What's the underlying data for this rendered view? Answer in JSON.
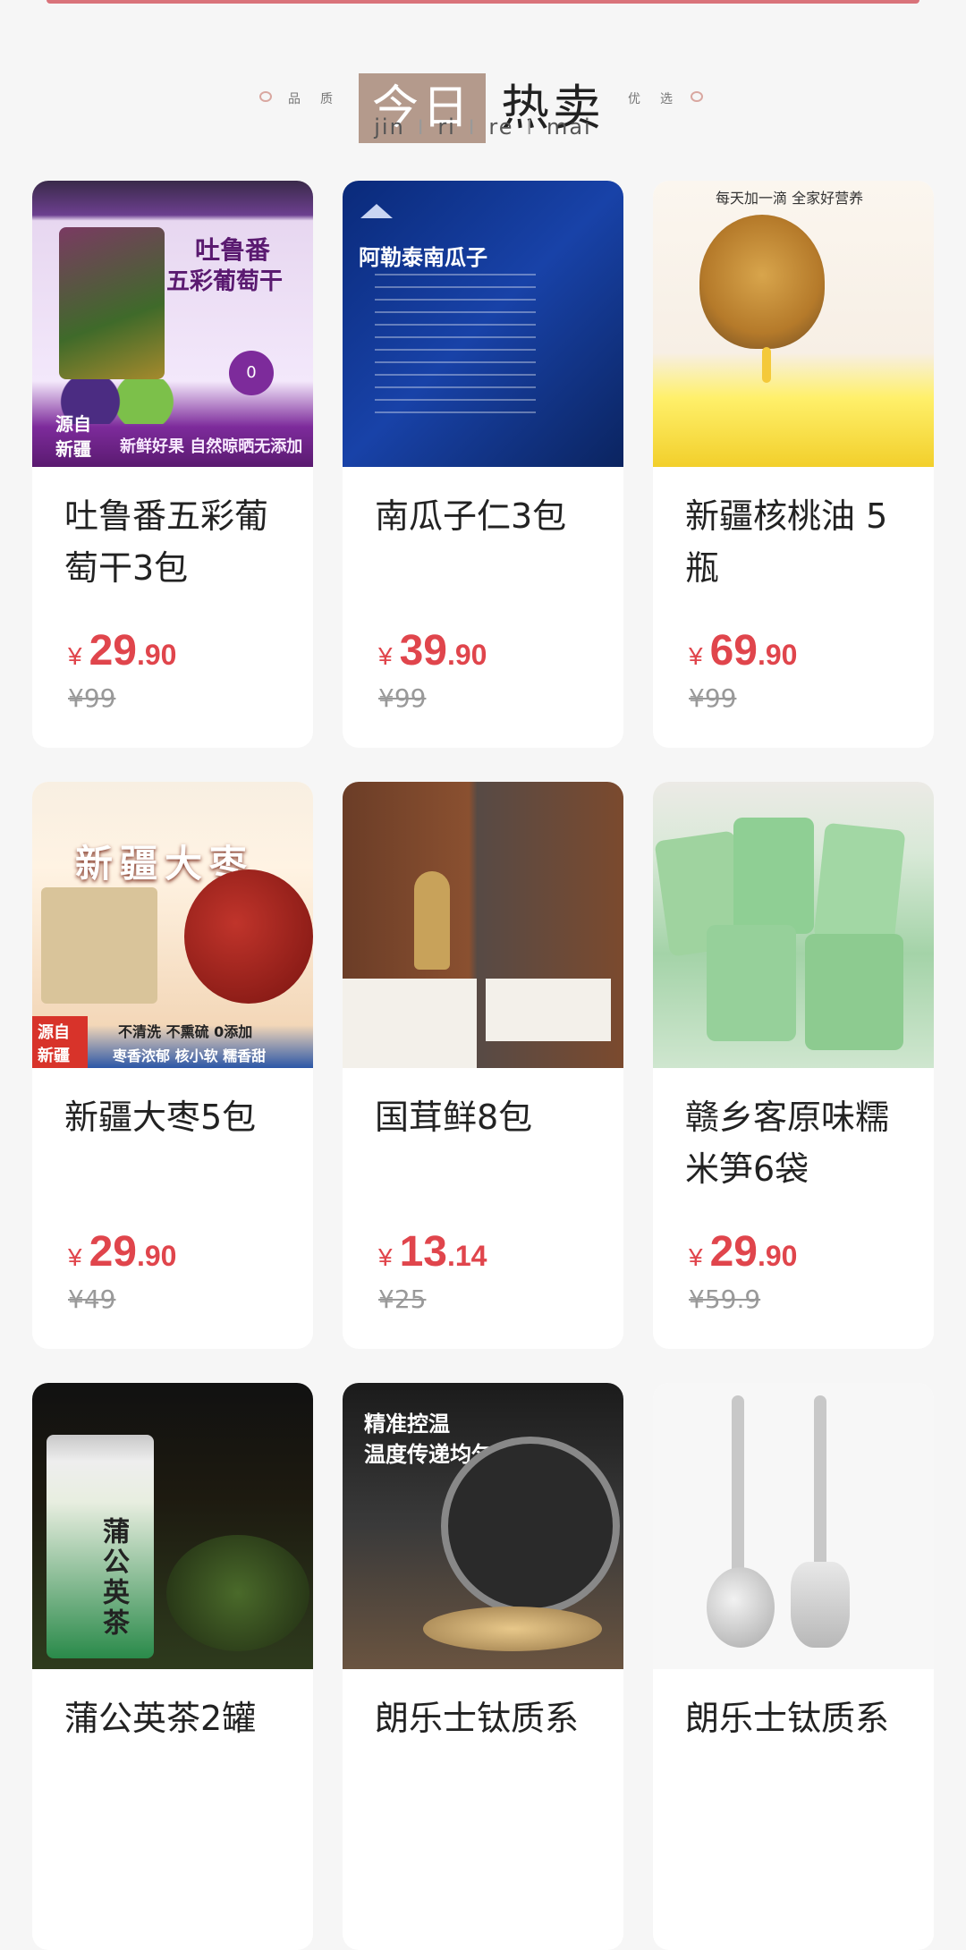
{
  "header": {
    "side_left": "品质",
    "side_right": "优选",
    "today": "今日",
    "hot": "热卖",
    "pinyin": [
      "jin",
      "ri",
      "re",
      "mai"
    ]
  },
  "colors": {
    "price": "#e0454c",
    "accent_box": "#b49a8c",
    "top_bar": "#d9737a"
  },
  "products": [
    {
      "title": "吐鲁番五彩葡萄干3包",
      "price_int": "29",
      "price_dec": ".90",
      "orig_price": "¥99",
      "image_text": [
        "吐鲁番",
        "五彩葡萄干",
        "源自",
        "新疆",
        "新鲜好果 自然晾晒无添加"
      ]
    },
    {
      "title": "南瓜子仁3包",
      "price_int": "39",
      "price_dec": ".90",
      "orig_price": "¥99",
      "image_text": [
        "阿勒泰南瓜子"
      ]
    },
    {
      "title": "新疆核桃油 5瓶",
      "price_int": "69",
      "price_dec": ".90",
      "orig_price": "¥99",
      "image_text": [
        "每天加一滴 全家好营养"
      ]
    },
    {
      "title": "新疆大枣5包",
      "price_int": "29",
      "price_dec": ".90",
      "orig_price": "¥49",
      "image_text": [
        "新疆大枣",
        "源自",
        "新疆",
        "不清洗 不熏硫 0添加",
        "枣香浓郁 核小软 糯香甜"
      ]
    },
    {
      "title": "国茸鲜8包",
      "price_int": "13",
      "price_dec": ".14",
      "orig_price": "¥25",
      "image_text": []
    },
    {
      "title": "赣乡客原味糯米笋6袋",
      "price_int": "29",
      "price_dec": ".90",
      "orig_price": "¥59.9",
      "image_text": []
    },
    {
      "title": "蒲公英茶2罐",
      "price_int": "",
      "price_dec": "",
      "orig_price": "",
      "image_text": [
        "蒲公英茶"
      ]
    },
    {
      "title": "朗乐士钛质系",
      "price_int": "",
      "price_dec": "",
      "orig_price": "",
      "image_text": [
        "精准控温",
        "温度传递均匀"
      ]
    },
    {
      "title": "朗乐士钛质系",
      "price_int": "",
      "price_dec": "",
      "orig_price": "",
      "image_text": []
    }
  ],
  "currency": "¥"
}
